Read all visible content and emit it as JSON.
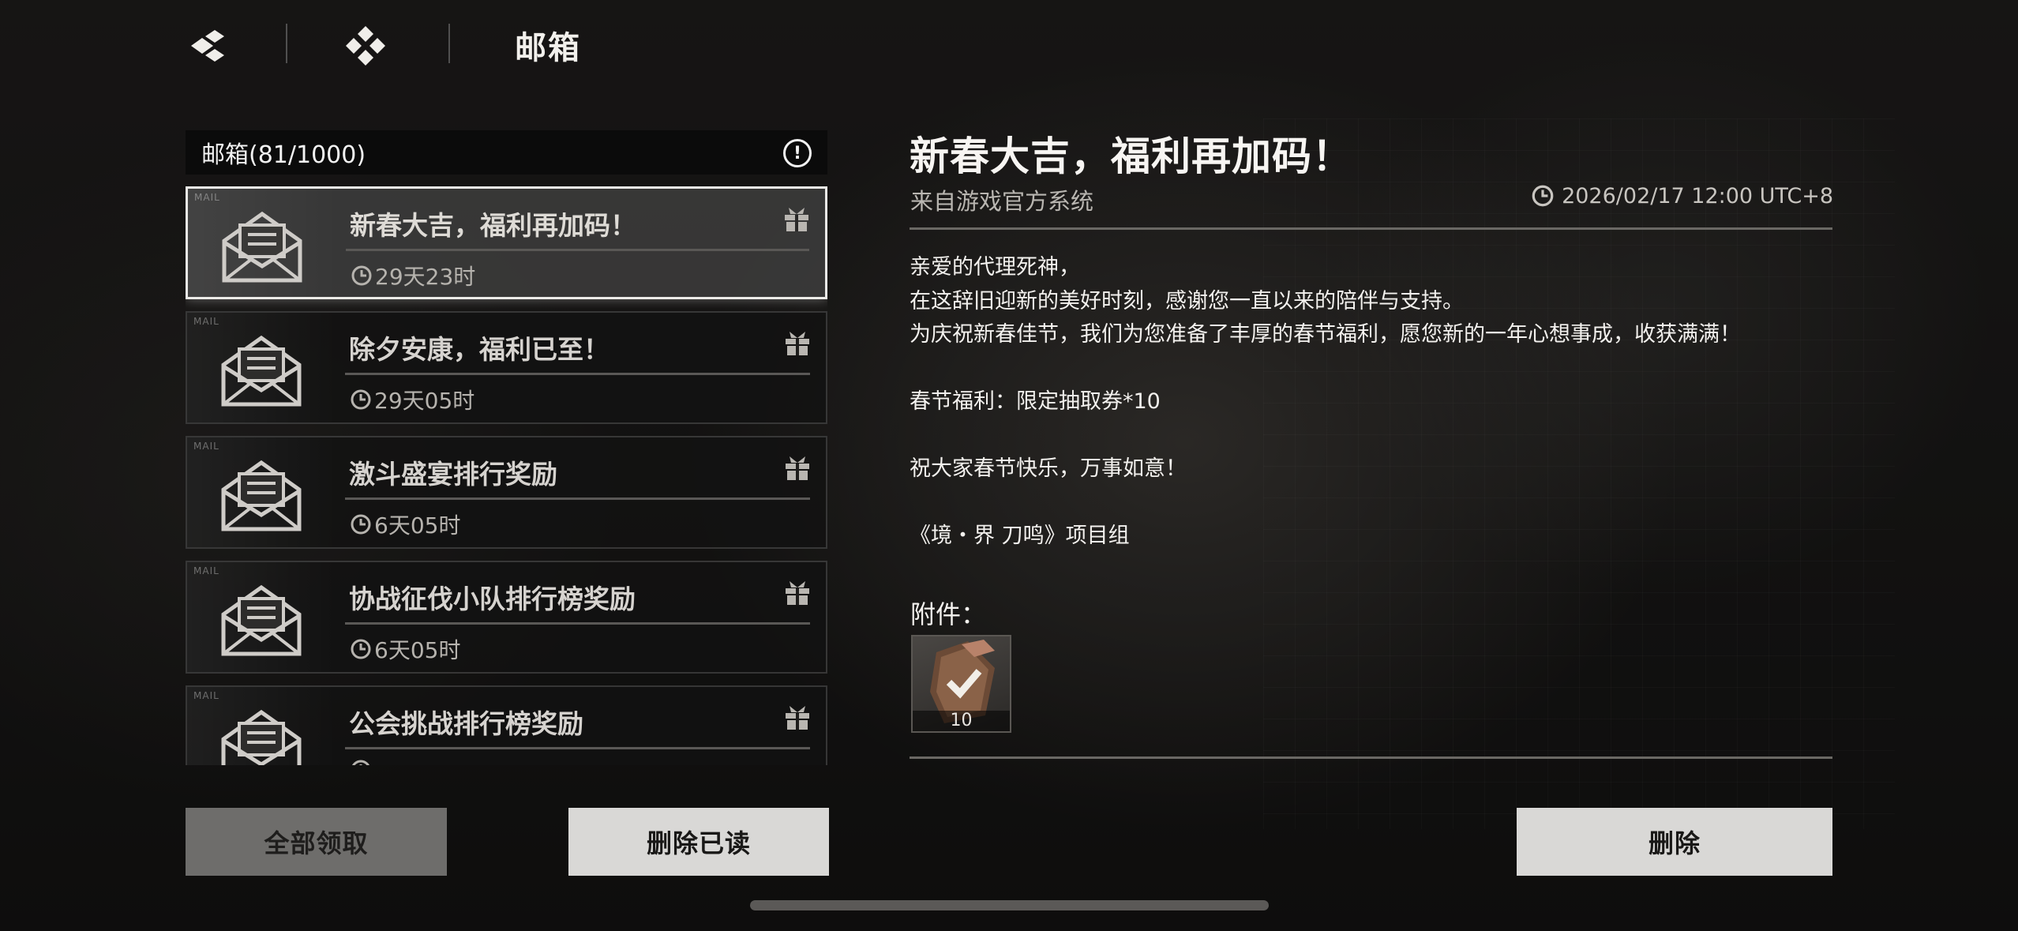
{
  "header": {
    "title": "邮箱"
  },
  "mail_list": {
    "header": "邮箱(81/1000)",
    "tag": "MAIL",
    "items": [
      {
        "title": "新春大吉，福利再加码！",
        "time": "29天23时",
        "selected": true
      },
      {
        "title": "除夕安康，福利已至！",
        "time": "29天05时",
        "selected": false
      },
      {
        "title": "激斗盛宴排行奖励",
        "time": "6天05时",
        "selected": false
      },
      {
        "title": "协战征伐小队排行榜奖励",
        "time": "6天05时",
        "selected": false
      },
      {
        "title": "公会挑战排行榜奖励",
        "time": "",
        "selected": false
      }
    ]
  },
  "detail": {
    "title": "新春大吉，福利再加码！",
    "sender": "来自游戏官方系统",
    "date": "2026/02/17 12:00 UTC+8",
    "body": [
      "亲爱的代理死神，",
      "在这辞旧迎新的美好时刻，感谢您一直以来的陪伴与支持。",
      "为庆祝新春佳节，我们为您准备了丰厚的春节福利，愿您新的一年心想事成，收获满满！",
      "",
      "春节福利：限定抽取券*10",
      "",
      "祝大家春节快乐，万事如意！",
      "",
      "《境・界 刀鸣》项目组"
    ],
    "attachments_label": "附件：",
    "attachments": [
      {
        "icon": "draw-ticket-icon",
        "count": "10"
      }
    ]
  },
  "buttons": {
    "claim_all": "全部领取",
    "delete_read": "删除已读",
    "delete": "删除"
  },
  "colors": {
    "background": "#1b1a19",
    "selected_border": "#ecebe8",
    "button_light": "#d9d8d6",
    "button_disabled": "#6e6d6b"
  }
}
